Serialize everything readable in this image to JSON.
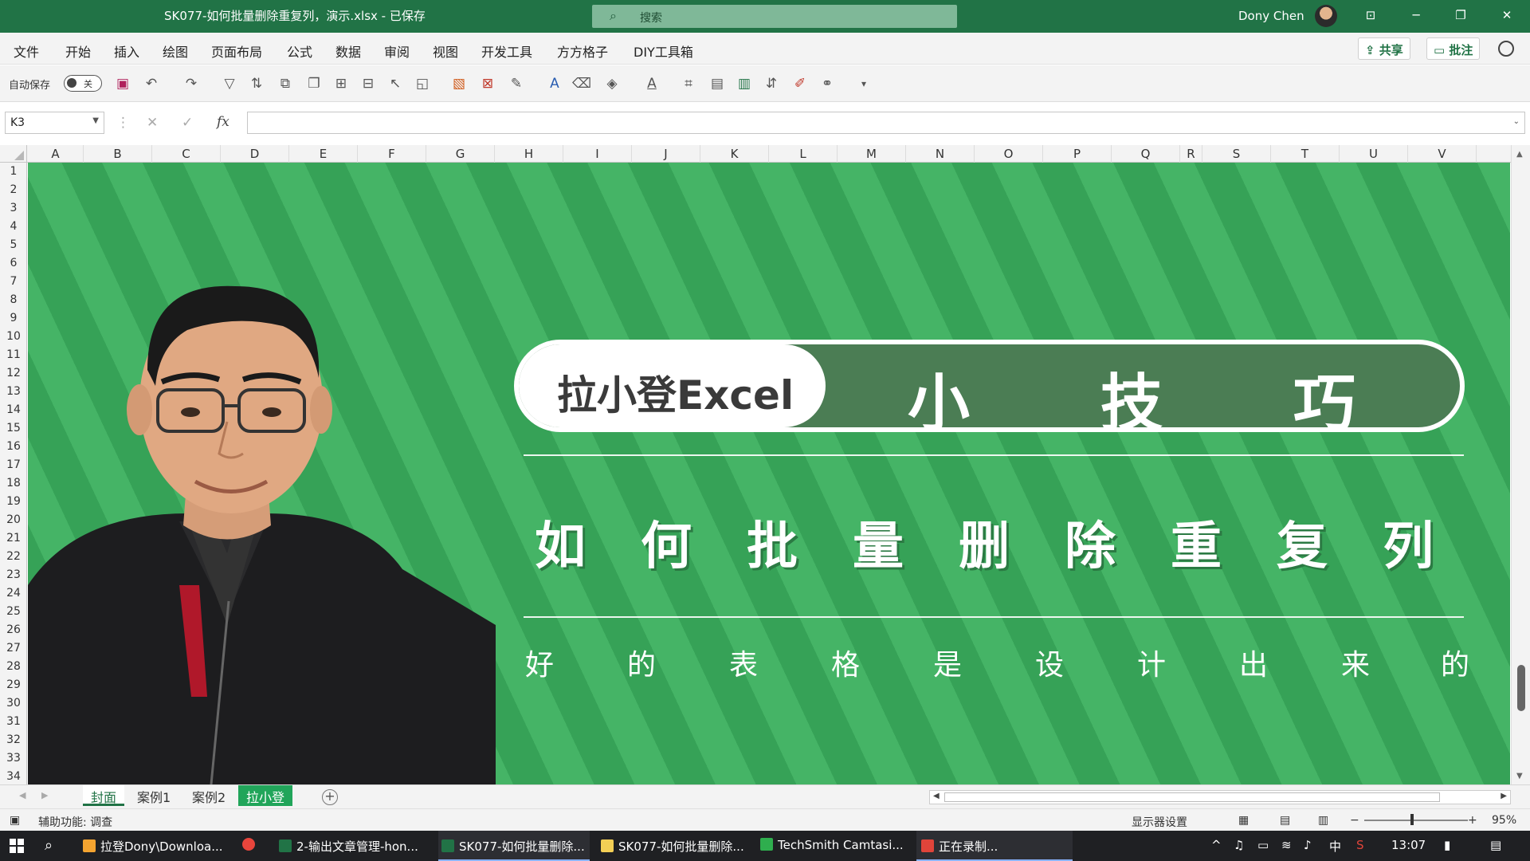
{
  "window": {
    "title": "SK077-如何批量删除重复列，演示.xlsx - 已保存",
    "search_placeholder": "搜索",
    "user_name": "Dony Chen",
    "min": "─",
    "restore": "❐",
    "close": "✕",
    "ribbon_display": "⊡"
  },
  "menu": {
    "items": [
      "文件",
      "开始",
      "插入",
      "绘图",
      "页面布局",
      "公式",
      "数据",
      "审阅",
      "视图",
      "开发工具",
      "方方格子",
      "DIY工具箱"
    ],
    "share": "共享",
    "comments": "批注"
  },
  "toolbar": {
    "autosave_label": "自动保存",
    "toggle_state": "关"
  },
  "formula_bar": {
    "name_box": "K3",
    "formula": "",
    "fx": "fx"
  },
  "grid": {
    "columns": [
      "A",
      "B",
      "C",
      "D",
      "E",
      "F",
      "G",
      "H",
      "I",
      "J",
      "K",
      "L",
      "M",
      "N",
      "O",
      "P",
      "Q",
      "R",
      "S",
      "T",
      "U",
      "V"
    ],
    "rows": [
      "1",
      "2",
      "3",
      "4",
      "5",
      "6",
      "7",
      "8",
      "9",
      "10",
      "11",
      "12",
      "13",
      "14",
      "15",
      "16",
      "17",
      "18",
      "19",
      "20",
      "21",
      "22",
      "23",
      "24",
      "25",
      "26",
      "27",
      "28",
      "29",
      "30",
      "31",
      "32",
      "33",
      "34"
    ]
  },
  "cover": {
    "brand": "拉小登Excel",
    "keywords": [
      "小",
      "技",
      "巧"
    ],
    "headline": [
      "如",
      "何",
      "批",
      "量",
      "删",
      "除",
      "重",
      "复",
      "列"
    ],
    "subtitle": [
      "好",
      "的",
      "表",
      "格",
      "是",
      "设",
      "计",
      "出",
      "来",
      "的"
    ]
  },
  "sheets": {
    "tabs": [
      "封面",
      "案例1",
      "案例2",
      "拉小登"
    ]
  },
  "status": {
    "accessibility": "辅助功能: 调查",
    "display_settings": "显示器设置",
    "zoom": "95%",
    "zoom_minus": "−",
    "zoom_plus": "+"
  },
  "taskbar": {
    "apps": [
      "拉登Dony\\Downloa...",
      "2-输出文章管理-hon...",
      "SK077-如何批量删除...",
      "SK077-如何批量删除...",
      "TechSmith Camtasi...",
      "正在录制..."
    ],
    "ime": "中",
    "time": "13:07"
  },
  "colors": {
    "excel_green": "#217346",
    "banner_green": "#3aa95c",
    "pill_dark": "#4b7d54"
  }
}
